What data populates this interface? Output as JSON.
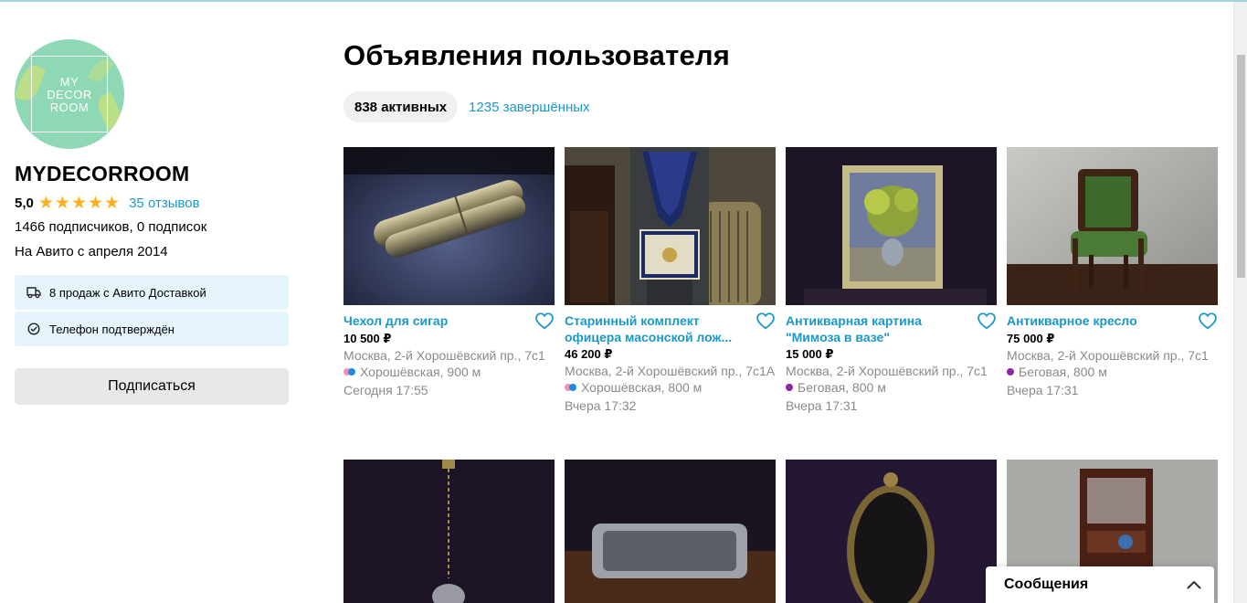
{
  "seller": {
    "avatar_text": [
      "MY",
      "DECOR",
      "ROOM"
    ],
    "name": "MYDECORROOM",
    "rating": "5,0",
    "stars": 5,
    "reviews": "35 отзывов",
    "followers": "1466 подписчиков, 0 подписок",
    "since": "На Авито с апреля 2014",
    "badges": [
      {
        "icon": "truck-icon",
        "text": "8 продаж с Авито Доставкой"
      },
      {
        "icon": "check-circle-icon",
        "text": "Телефон подтверждён"
      }
    ],
    "subscribe": "Подписаться"
  },
  "main": {
    "title": "Объявления пользователя",
    "tabs": {
      "active": "838 активных",
      "completed": "1235 завершённых"
    }
  },
  "listings": [
    {
      "title": "Чехол для сигар",
      "price": "10 500 ₽",
      "address": "Москва, 2-й Хорошёвский пр., 7с1",
      "metro": "Хорошёвская, 900 м",
      "metro_colors": [
        "#f48fb1",
        "#1e88e5"
      ],
      "date": "Сегодня 17:55"
    },
    {
      "title": "Старинный комплект офицера масонской лож...",
      "price": "46 200 ₽",
      "address": "Москва, 2-й Хорошёвский пр., 7с1А",
      "metro": "Хорошёвская, 800 м",
      "metro_colors": [
        "#f48fb1",
        "#1e88e5"
      ],
      "date": "Вчера 17:32"
    },
    {
      "title": "Антикварная картина \"Мимоза в вазе\"",
      "price": "15 000 ₽",
      "address": "Москва, 2-й Хорошёвский пр., 7с1",
      "metro": "Беговая, 800 м",
      "metro_colors": [
        "#8e24aa"
      ],
      "date": "Вчера 17:31"
    },
    {
      "title": "Антикварное кресло",
      "price": "75 000 ₽",
      "address": "Москва, 2-й Хорошёвский пр., 7с1",
      "metro": "Беговая, 800 м",
      "metro_colors": [
        "#8e24aa"
      ],
      "date": "Вчера 17:31"
    }
  ],
  "messages": {
    "label": "Сообщения"
  },
  "colors": {
    "accent": "#1a98c9",
    "star": "#ffb021",
    "badge_bg": "#e5f5fb"
  }
}
